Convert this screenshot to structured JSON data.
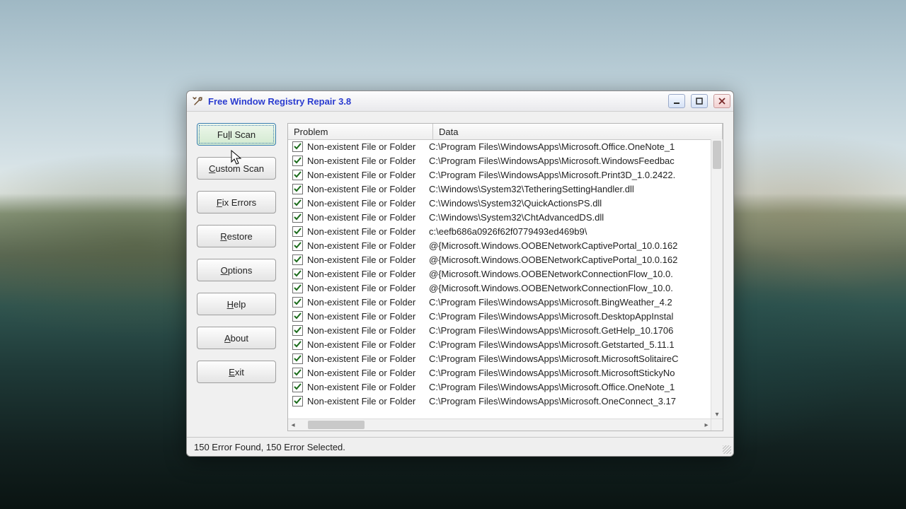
{
  "window": {
    "title": "Free Window Registry Repair 3.8"
  },
  "sidebar": {
    "buttons": [
      {
        "id": "full-scan",
        "label_pre": "Fu",
        "label_ul": "l",
        "label_post": "l Scan"
      },
      {
        "id": "custom-scan",
        "label_pre": "",
        "label_ul": "C",
        "label_post": "ustom Scan"
      },
      {
        "id": "fix-errors",
        "label_pre": "",
        "label_ul": "F",
        "label_post": "ix Errors"
      },
      {
        "id": "restore",
        "label_pre": "",
        "label_ul": "R",
        "label_post": "estore"
      },
      {
        "id": "options",
        "label_pre": "",
        "label_ul": "O",
        "label_post": "ptions"
      },
      {
        "id": "help",
        "label_pre": "",
        "label_ul": "H",
        "label_post": "elp"
      },
      {
        "id": "about",
        "label_pre": "",
        "label_ul": "A",
        "label_post": "bout"
      },
      {
        "id": "exit",
        "label_pre": "",
        "label_ul": "E",
        "label_post": "xit"
      }
    ]
  },
  "columns": {
    "problem": "Problem",
    "data": "Data"
  },
  "rows": [
    {
      "checked": true,
      "problem": "Non-existent File or Folder",
      "data": "C:\\Program Files\\WindowsApps\\Microsoft.Office.OneNote_1"
    },
    {
      "checked": true,
      "problem": "Non-existent File or Folder",
      "data": "C:\\Program Files\\WindowsApps\\Microsoft.WindowsFeedbac"
    },
    {
      "checked": true,
      "problem": "Non-existent File or Folder",
      "data": "C:\\Program Files\\WindowsApps\\Microsoft.Print3D_1.0.2422."
    },
    {
      "checked": true,
      "problem": "Non-existent File or Folder",
      "data": "C:\\Windows\\System32\\TetheringSettingHandler.dll"
    },
    {
      "checked": true,
      "problem": "Non-existent File or Folder",
      "data": "C:\\Windows\\System32\\QuickActionsPS.dll"
    },
    {
      "checked": true,
      "problem": "Non-existent File or Folder",
      "data": "C:\\Windows\\System32\\ChtAdvancedDS.dll"
    },
    {
      "checked": true,
      "problem": "Non-existent File or Folder",
      "data": "c:\\eefb686a0926f62f0779493ed469b9\\"
    },
    {
      "checked": true,
      "problem": "Non-existent File or Folder",
      "data": "@{Microsoft.Windows.OOBENetworkCaptivePortal_10.0.162"
    },
    {
      "checked": true,
      "problem": "Non-existent File or Folder",
      "data": "@{Microsoft.Windows.OOBENetworkCaptivePortal_10.0.162"
    },
    {
      "checked": true,
      "problem": "Non-existent File or Folder",
      "data": "@{Microsoft.Windows.OOBENetworkConnectionFlow_10.0."
    },
    {
      "checked": true,
      "problem": "Non-existent File or Folder",
      "data": "@{Microsoft.Windows.OOBENetworkConnectionFlow_10.0."
    },
    {
      "checked": true,
      "problem": "Non-existent File or Folder",
      "data": "C:\\Program Files\\WindowsApps\\Microsoft.BingWeather_4.2"
    },
    {
      "checked": true,
      "problem": "Non-existent File or Folder",
      "data": "C:\\Program Files\\WindowsApps\\Microsoft.DesktopAppInstal"
    },
    {
      "checked": true,
      "problem": "Non-existent File or Folder",
      "data": "C:\\Program Files\\WindowsApps\\Microsoft.GetHelp_10.1706"
    },
    {
      "checked": true,
      "problem": "Non-existent File or Folder",
      "data": "C:\\Program Files\\WindowsApps\\Microsoft.Getstarted_5.11.1"
    },
    {
      "checked": true,
      "problem": "Non-existent File or Folder",
      "data": "C:\\Program Files\\WindowsApps\\Microsoft.MicrosoftSolitaireC"
    },
    {
      "checked": true,
      "problem": "Non-existent File or Folder",
      "data": "C:\\Program Files\\WindowsApps\\Microsoft.MicrosoftStickyNo"
    },
    {
      "checked": true,
      "problem": "Non-existent File or Folder",
      "data": "C:\\Program Files\\WindowsApps\\Microsoft.Office.OneNote_1"
    },
    {
      "checked": true,
      "problem": "Non-existent File or Folder",
      "data": "C:\\Program Files\\WindowsApps\\Microsoft.OneConnect_3.17"
    }
  ],
  "status": "150 Error Found,  150 Error Selected."
}
